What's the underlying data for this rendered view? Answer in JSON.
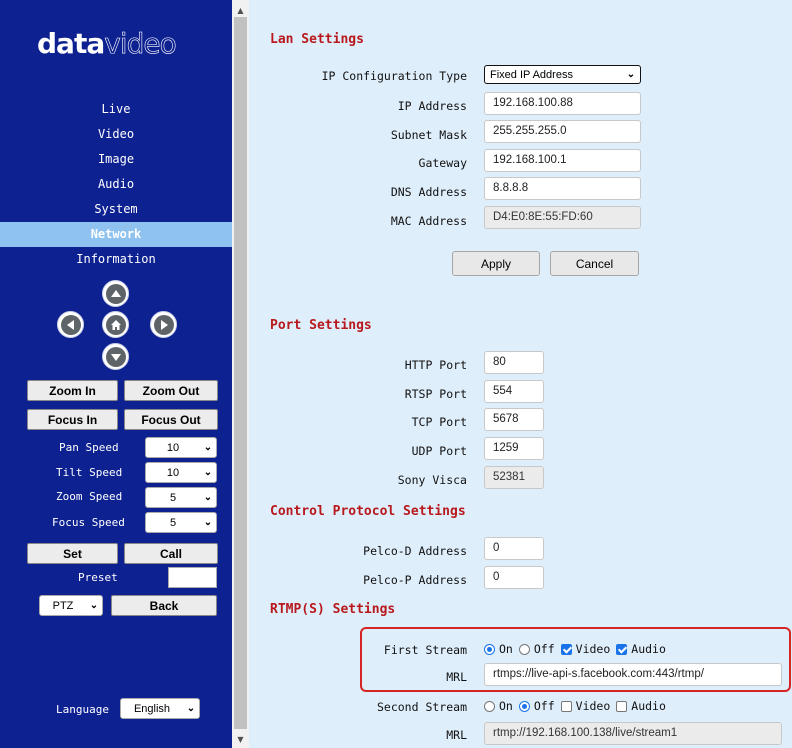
{
  "sidebar": {
    "logo_bold": "data",
    "logo_light": "video",
    "nav": [
      "Live",
      "Video",
      "Image",
      "Audio",
      "System",
      "Network",
      "Information"
    ],
    "active_nav": "Network",
    "ptz_icons": [
      "up-arrow-icon",
      "left-arrow-icon",
      "home-icon",
      "right-arrow-icon",
      "down-arrow-icon"
    ],
    "zoom_in": "Zoom In",
    "zoom_out": "Zoom Out",
    "focus_in": "Focus In",
    "focus_out": "Focus Out",
    "pan_speed_label": "Pan Speed",
    "pan_speed": "10",
    "tilt_speed_label": "Tilt Speed",
    "tilt_speed": "10",
    "zoom_speed_label": "Zoom Speed",
    "zoom_speed": "5",
    "focus_speed_label": "Focus Speed",
    "focus_speed": "5",
    "set": "Set",
    "call": "Call",
    "preset_label": "Preset",
    "mode": "PTZ",
    "back": "Back",
    "language_label": "Language",
    "language": "English"
  },
  "lan": {
    "title": "Lan Settings",
    "ip_config_label": "IP Configuration Type",
    "ip_config": "Fixed IP Address",
    "ip_label": "IP Address",
    "ip": "192.168.100.88",
    "subnet_label": "Subnet Mask",
    "subnet": "255.255.255.0",
    "gateway_label": "Gateway",
    "gateway": "192.168.100.1",
    "dns_label": "DNS Address",
    "dns": "8.8.8.8",
    "mac_label": "MAC Address",
    "mac": "D4:E0:8E:55:FD:60",
    "apply": "Apply",
    "cancel": "Cancel"
  },
  "port": {
    "title": "Port Settings",
    "http_label": "HTTP Port",
    "http": "80",
    "rtsp_label": "RTSP Port",
    "rtsp": "554",
    "tcp_label": "TCP Port",
    "tcp": "5678",
    "udp_label": "UDP Port",
    "udp": "1259",
    "visca_label": "Sony Visca",
    "visca": "52381"
  },
  "control": {
    "title": "Control Protocol Settings",
    "pelco_d_label": "Pelco-D Address",
    "pelco_d": "0",
    "pelco_p_label": "Pelco-P Address",
    "pelco_p": "0"
  },
  "rtmp": {
    "title": "RTMP(S) Settings",
    "first_label": "First Stream",
    "second_label": "Second Stream",
    "on": "On",
    "off": "Off",
    "video": "Video",
    "audio": "Audio",
    "mrl_label": "MRL",
    "first_mrl": "rtmps://live-api-s.facebook.com:443/rtmp/",
    "second_mrl": "rtmp://192.168.100.138/live/stream1",
    "first_state": "On",
    "second_state": "Off",
    "first_video_checked": true,
    "first_audio_checked": true,
    "second_video_checked": false,
    "second_audio_checked": false
  },
  "colors": {
    "sidebar_bg": "#0e2191",
    "active_nav_bg": "#8fc2ef",
    "content_bg": "#dfeefb",
    "section_title": "#b8191c",
    "highlight_border": "#d42424"
  }
}
